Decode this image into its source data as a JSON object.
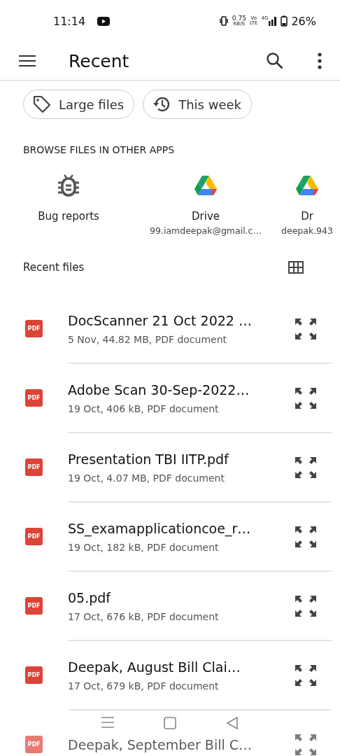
{
  "status_bar": {
    "time": "11:14",
    "speed": "0.75",
    "speed_unit": "KB/S",
    "volte_top": "Vo",
    "volte_bottom": "LTE",
    "network": "4G",
    "battery": "26%"
  },
  "app_bar": {
    "title": "Recent"
  },
  "chips": [
    {
      "label": "Large files",
      "kind": "tag"
    },
    {
      "label": "This week",
      "kind": "history"
    }
  ],
  "browse": {
    "heading": "BROWSE FILES IN OTHER APPS",
    "apps": [
      {
        "name": "Bug reports",
        "kind": "bug"
      },
      {
        "name": "Drive",
        "account": "99.iamdeepak@gmail.c…",
        "kind": "drive"
      },
      {
        "name": "Dr",
        "account": "deepak.943",
        "kind": "drive"
      }
    ]
  },
  "recent": {
    "heading": "Recent files",
    "files": [
      {
        "name": "DocScanner 21 Oct 2022 …",
        "details": "5 Nov, 44.82 MB, PDF document",
        "badge": "PDF"
      },
      {
        "name": "Adobe Scan 30-Sep-2022…",
        "details": "19 Oct, 406 kB, PDF document",
        "badge": "PDF"
      },
      {
        "name": "Presentation TBI IITP.pdf",
        "details": "19 Oct, 4.07 MB, PDF document",
        "badge": "PDF"
      },
      {
        "name": "SS_examapplicationcoe_r…",
        "details": "19 Oct, 182 kB, PDF document",
        "badge": "PDF"
      },
      {
        "name": "05.pdf",
        "details": "17 Oct, 676 kB, PDF document",
        "badge": "PDF"
      },
      {
        "name": "Deepak, August Bill Clai…",
        "details": "17 Oct, 679 kB, PDF document",
        "badge": "PDF"
      },
      {
        "name": "Deepak, September Bill C…",
        "badge": "PDF"
      }
    ]
  }
}
